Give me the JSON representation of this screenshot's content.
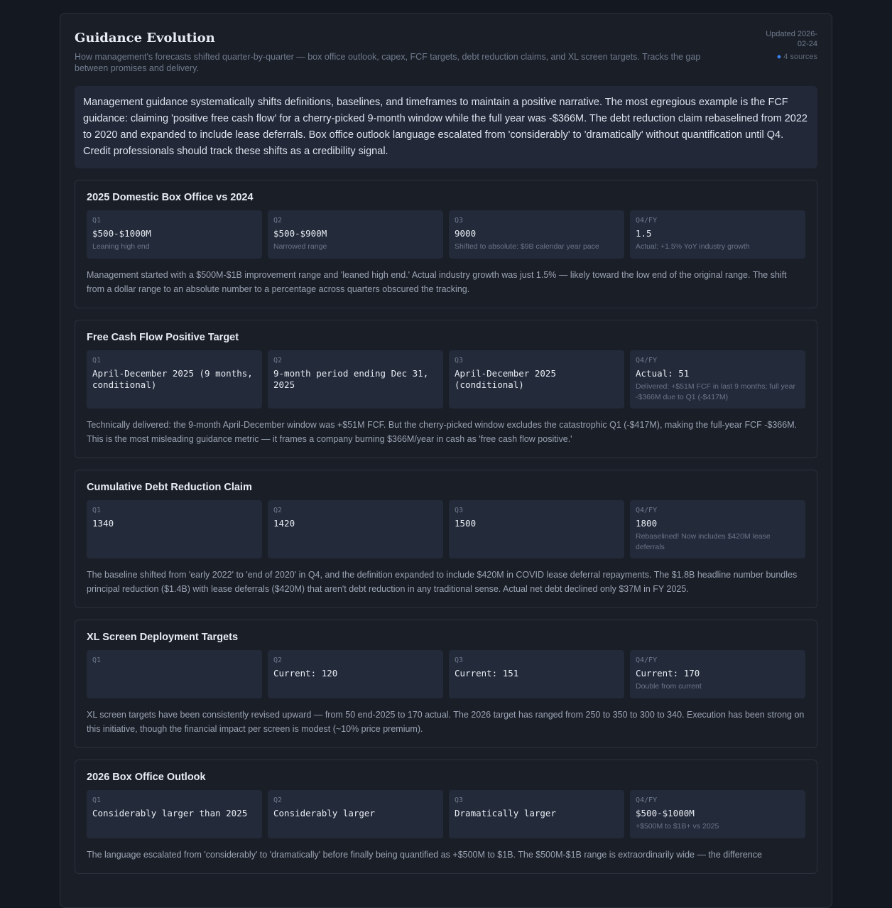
{
  "header": {
    "title": "Guidance Evolution",
    "subtitle": "How management's forecasts shifted quarter-by-quarter — box office outlook, capex, FCF targets, debt reduction claims, and XL screen targets. Tracks the gap between promises and delivery.",
    "updated": "Updated 2026-02-24",
    "sources": "4 sources"
  },
  "summary": "Management guidance systematically shifts definitions, baselines, and timeframes to maintain a positive narrative. The most egregious example is the FCF guidance: claiming 'positive free cash flow' for a cherry-picked 9-month window while the full year was -$366M. The debt reduction claim rebaselined from 2022 to 2020 and expanded to include lease deferrals. Box office outlook language escalated from 'considerably' to 'dramatically' without quantification until Q4. Credit professionals should track these shifts as a credibility signal.",
  "sections": [
    {
      "title": "2025 Domestic Box Office vs 2024",
      "quarters": [
        {
          "label": "Q1",
          "value": "$500-$1000M",
          "note": "Leaning high end"
        },
        {
          "label": "Q2",
          "value": "$500-$900M",
          "note": "Narrowed range"
        },
        {
          "label": "Q3",
          "value": "9000",
          "note": "Shifted to absolute: $9B calendar year pace"
        },
        {
          "label": "Q4/FY",
          "value": "1.5",
          "note": "Actual: +1.5% YoY industry growth"
        }
      ],
      "analysis": "Management started with a $500M-$1B improvement range and 'leaned high end.' Actual industry growth was just 1.5% — likely toward the low end of the original range. The shift from a dollar range to an absolute number to a percentage across quarters obscured the tracking."
    },
    {
      "title": "Free Cash Flow Positive Target",
      "quarters": [
        {
          "label": "Q1",
          "value": "April-December 2025 (9 months, conditional)",
          "note": ""
        },
        {
          "label": "Q2",
          "value": "9-month period ending Dec 31, 2025",
          "note": ""
        },
        {
          "label": "Q3",
          "value": "April-December 2025 (conditional)",
          "note": ""
        },
        {
          "label": "Q4/FY",
          "value": "Actual: 51",
          "note": "Delivered: +$51M FCF in last 9 months; full year -$366M due to Q1 (-$417M)"
        }
      ],
      "analysis": "Technically delivered: the 9-month April-December window was +$51M FCF. But the cherry-picked window excludes the catastrophic Q1 (-$417M), making the full-year FCF -$366M. This is the most misleading guidance metric — it frames a company burning $366M/year in cash as 'free cash flow positive.'"
    },
    {
      "title": "Cumulative Debt Reduction Claim",
      "quarters": [
        {
          "label": "Q1",
          "value": "1340",
          "note": ""
        },
        {
          "label": "Q2",
          "value": "1420",
          "note": ""
        },
        {
          "label": "Q3",
          "value": "1500",
          "note": ""
        },
        {
          "label": "Q4/FY",
          "value": "1800",
          "note": "Rebaselined! Now includes $420M lease deferrals"
        }
      ],
      "analysis": "The baseline shifted from 'early 2022' to 'end of 2020' in Q4, and the definition expanded to include $420M in COVID lease deferral repayments. The $1.8B headline number bundles principal reduction ($1.4B) with lease deferrals ($420M) that aren't debt reduction in any traditional sense. Actual net debt declined only $37M in FY 2025."
    },
    {
      "title": "XL Screen Deployment Targets",
      "quarters": [
        {
          "label": "Q1",
          "value": "",
          "note": ""
        },
        {
          "label": "Q2",
          "value": "Current: 120",
          "note": ""
        },
        {
          "label": "Q3",
          "value": "Current: 151",
          "note": ""
        },
        {
          "label": "Q4/FY",
          "value": "Current: 170",
          "note": "Double from current"
        }
      ],
      "analysis": "XL screen targets have been consistently revised upward — from 50 end-2025 to 170 actual. The 2026 target has ranged from 250 to 350 to 300 to 340. Execution has been strong on this initiative, though the financial impact per screen is modest (~10% price premium)."
    },
    {
      "title": "2026 Box Office Outlook",
      "quarters": [
        {
          "label": "Q1",
          "value": "Considerably larger than 2025",
          "note": ""
        },
        {
          "label": "Q2",
          "value": "Considerably larger",
          "note": ""
        },
        {
          "label": "Q3",
          "value": "Dramatically larger",
          "note": ""
        },
        {
          "label": "Q4/FY",
          "value": "$500-$1000M",
          "note": "+$500M to $1B+ vs 2025"
        }
      ],
      "analysis": "The language escalated from 'considerably' to 'dramatically' before finally being quantified as +$500M to $1B. The $500M-$1B range is extraordinarily wide — the difference"
    }
  ]
}
